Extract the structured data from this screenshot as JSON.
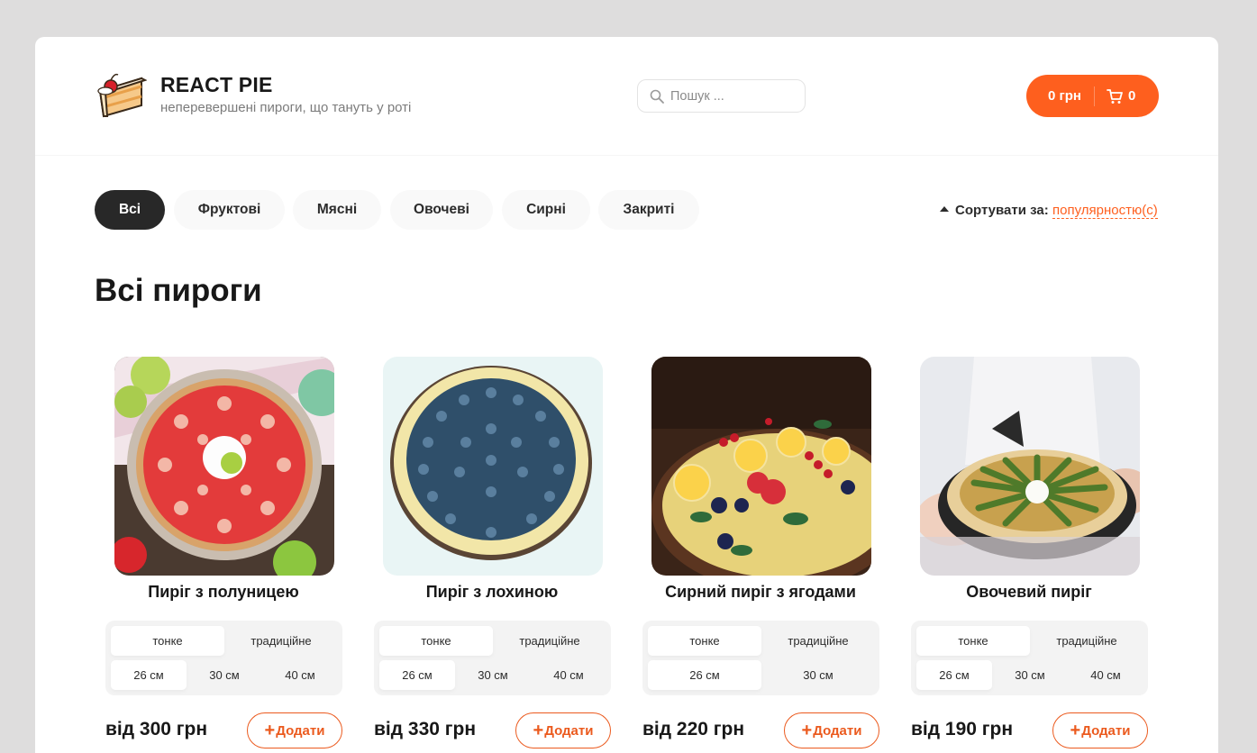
{
  "brand": {
    "title": "REACT PIE",
    "subtitle": "неперевершені пироги, що тануть у роті",
    "logo_icon": "pie-slice-logo-icon"
  },
  "search": {
    "placeholder": "Пошук ...",
    "value": "",
    "icon": "search-icon"
  },
  "cart": {
    "price": "0 грн",
    "count": "0",
    "icon": "cart-icon",
    "color": "#fe5f1e"
  },
  "categories": [
    "Всі",
    "Фруктові",
    "Мясні",
    "Овочеві",
    "Сирні",
    "Закриті"
  ],
  "active_category": "Всі",
  "sort": {
    "label": "Сортувати за:",
    "value": "популярностю(c)",
    "icon": "sort-up-arrow-icon"
  },
  "page_title": "Всі пироги",
  "products": [
    {
      "name": "Пиріг з полуницею",
      "image": "strawberry-pie-image",
      "types": [
        "тонке",
        "традиційне"
      ],
      "selected_type": "тонке",
      "sizes": [
        "26 см",
        "30 см",
        "40 см"
      ],
      "selected_size": "26 см",
      "price": "від 300 грн",
      "add_label": "Додати"
    },
    {
      "name": "Пиріг з лохиною",
      "image": "blueberry-pie-image",
      "types": [
        "тонке",
        "традиційне"
      ],
      "selected_type": "тонке",
      "sizes": [
        "26 см",
        "30 см",
        "40 см"
      ],
      "selected_size": "26 см",
      "price": "від 330 грн",
      "add_label": "Додати"
    },
    {
      "name": "Сирний пиріг з ягодами",
      "image": "cheese-berry-pie-image",
      "types": [
        "тонке",
        "традиційне"
      ],
      "selected_type": "тонке",
      "sizes": [
        "26 см",
        "30 см"
      ],
      "selected_size": "26 см",
      "price": "від 220 грн",
      "add_label": "Додати"
    },
    {
      "name": "Овочевий пиріг",
      "image": "vegetable-pie-image",
      "types": [
        "тонке",
        "традиційне"
      ],
      "selected_type": "тонке",
      "sizes": [
        "26 см",
        "30 см",
        "40 см"
      ],
      "selected_size": "26 см",
      "price": "від 190 грн",
      "add_label": "Додати"
    }
  ],
  "colors": {
    "accent": "#fe5f1e",
    "active_category_bg": "#282828",
    "page_bg": "#dedddd"
  }
}
